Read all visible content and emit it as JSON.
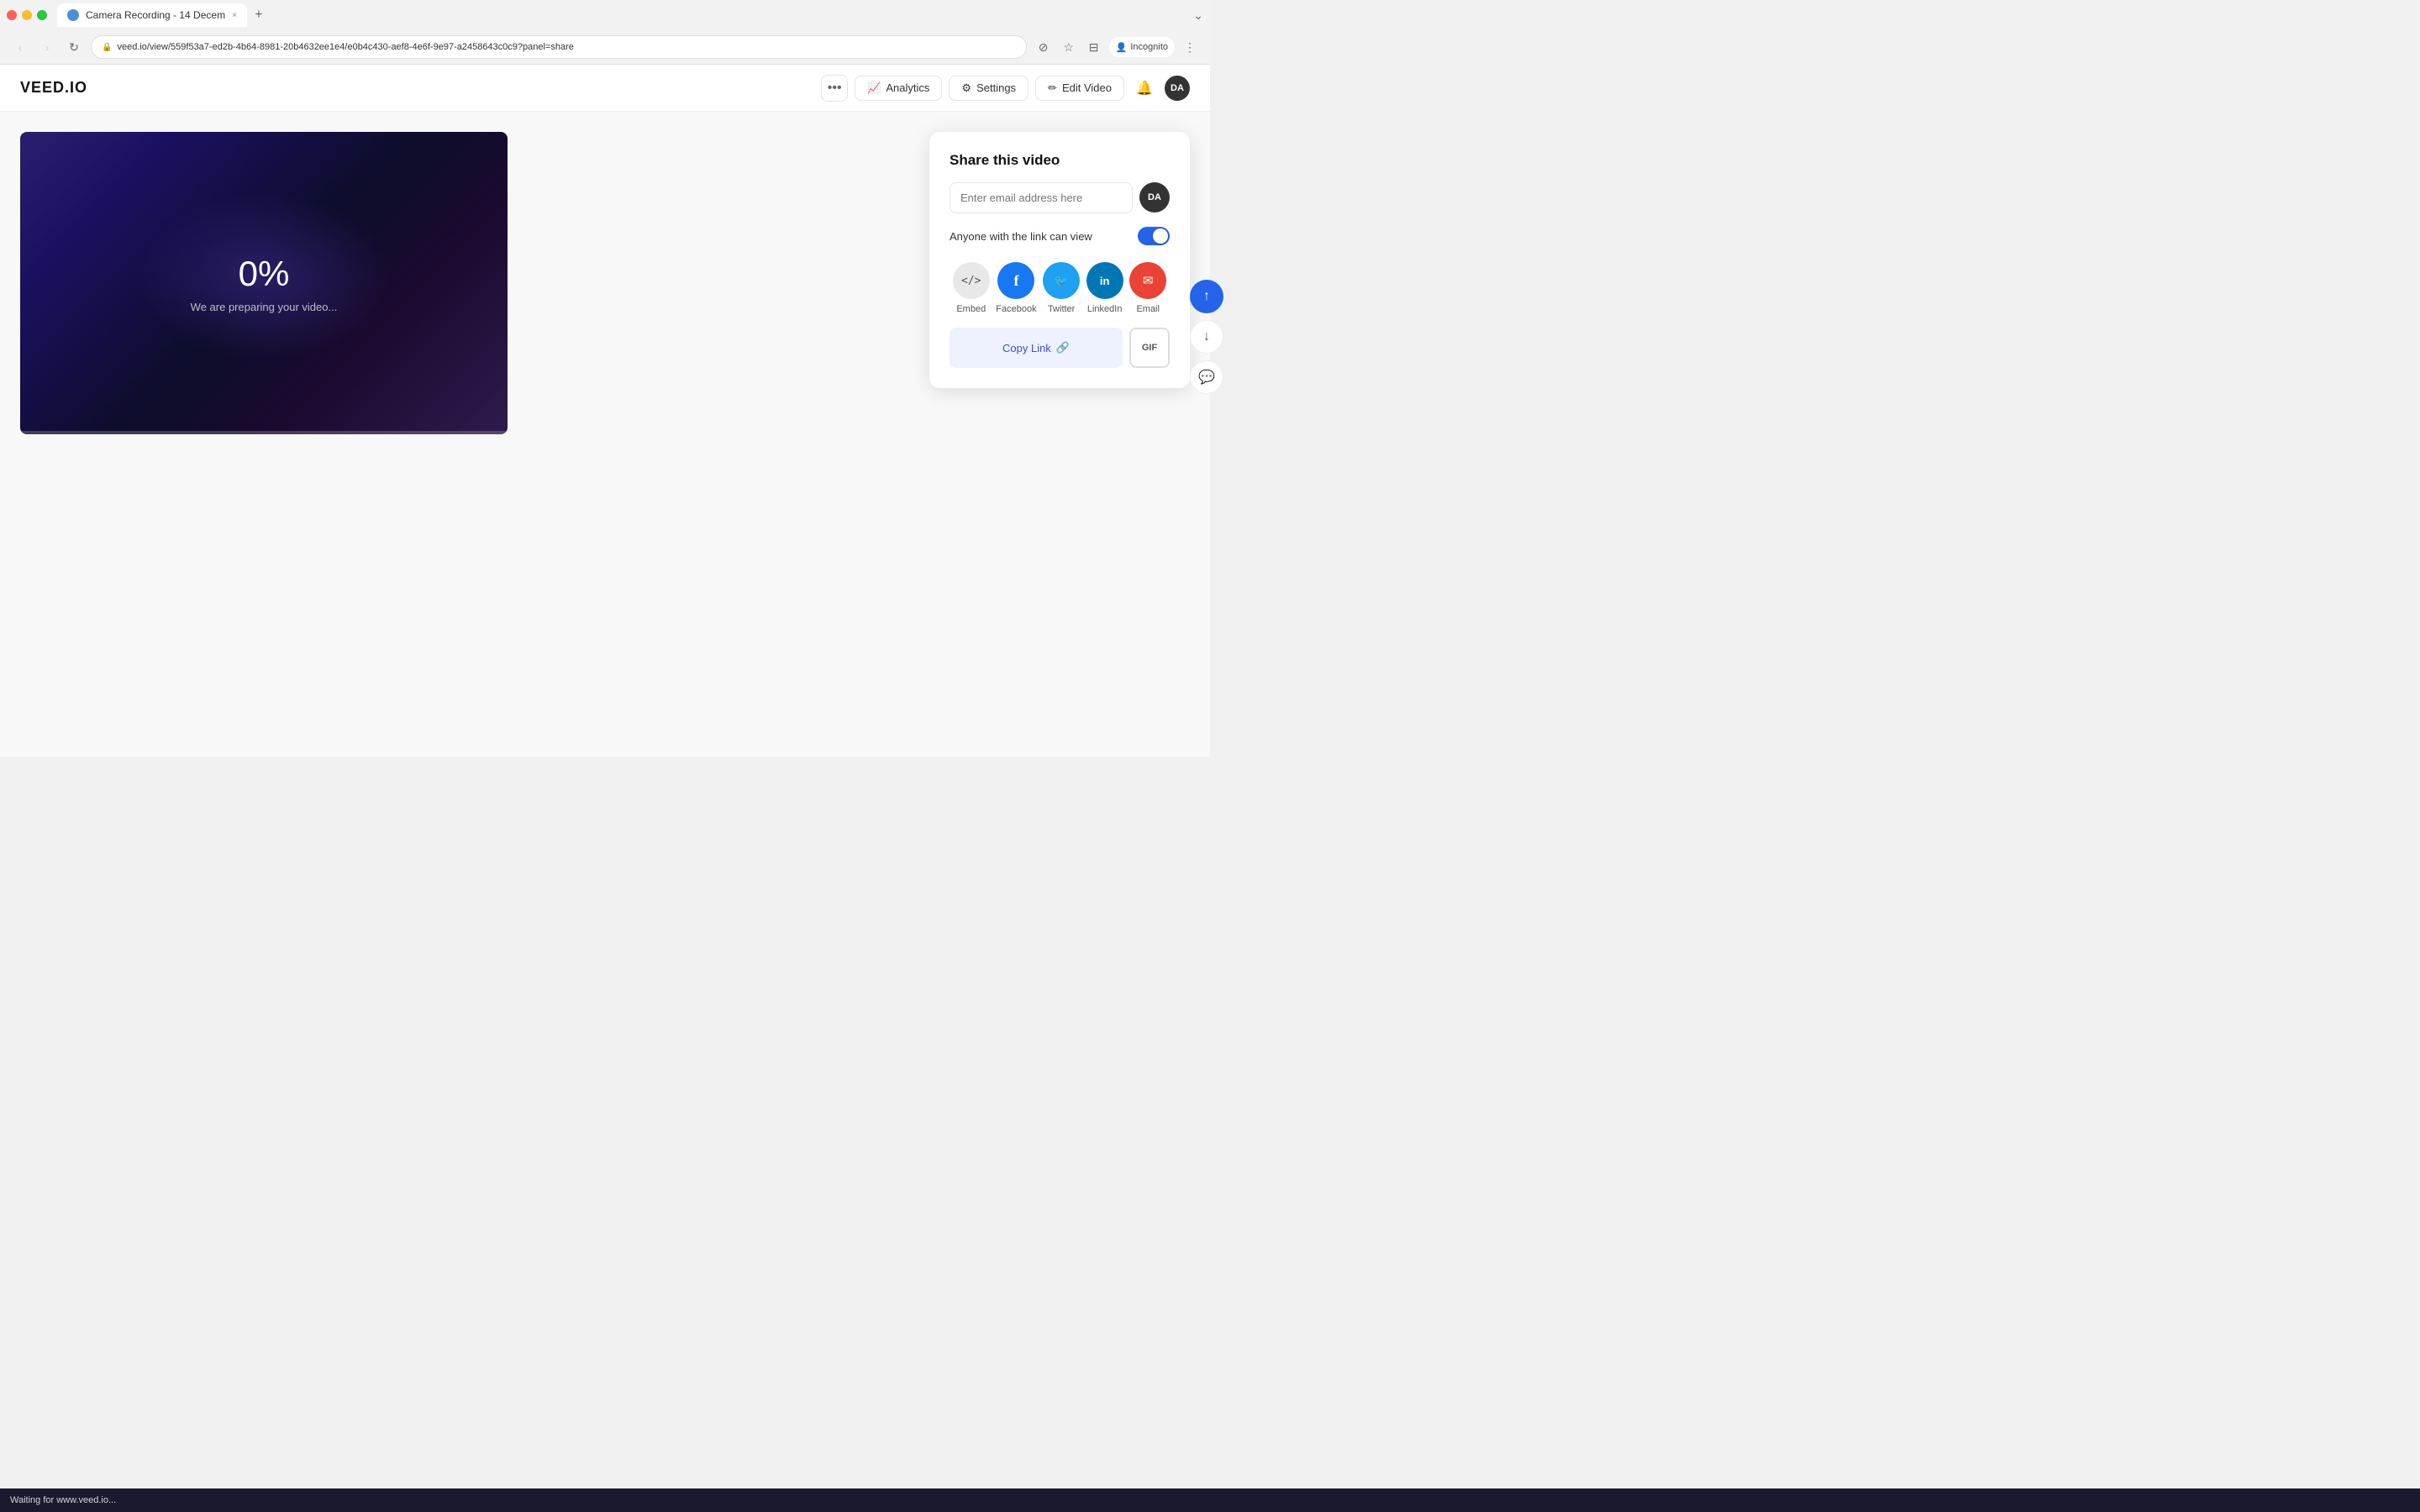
{
  "browser": {
    "tab_title": "Camera Recording - 14 Decem",
    "tab_close": "×",
    "tab_new": "+",
    "more_tabs": "⌄",
    "url": "veed.io/view/559f53a7-ed2b-4b64-8981-20b4632ee1e4/e0b4c430-aef8-4e6f-9e97-a2458643c0c9?panel=share",
    "lock_icon": "🔒",
    "nav_back": "‹",
    "nav_forward": "›",
    "nav_refresh": "↻",
    "incognito_label": "Incognito",
    "action_icons": [
      "⋮",
      "★",
      "⊟",
      "👤"
    ]
  },
  "header": {
    "logo": "VEED.IO",
    "more_label": "•••",
    "analytics_label": "Analytics",
    "settings_label": "Settings",
    "edit_video_label": "Edit Video",
    "notification_icon": "🔔",
    "avatar_label": "DA"
  },
  "video": {
    "progress": "0%",
    "preparing_text": "We are preparing your video...",
    "progress_fill": 0
  },
  "share_panel": {
    "title": "Share this video",
    "email_placeholder": "Enter email address here",
    "avatar_label": "DA",
    "link_toggle_label": "Anyone with the link can view",
    "social_items": [
      {
        "id": "embed",
        "label": "Embed",
        "icon": "</>",
        "style": "embed"
      },
      {
        "id": "facebook",
        "label": "Facebook",
        "icon": "f",
        "style": "facebook"
      },
      {
        "id": "twitter",
        "label": "Twitter",
        "icon": "🐦",
        "style": "twitter"
      },
      {
        "id": "linkedin",
        "label": "LinkedIn",
        "icon": "in",
        "style": "linkedin"
      },
      {
        "id": "email",
        "label": "Email",
        "icon": "✉",
        "style": "email"
      }
    ],
    "copy_link_label": "Copy Link",
    "copy_link_icon": "🔗",
    "gif_label": "GIF"
  },
  "sidebar": {
    "share_icon": "↑",
    "download_icon": "↓",
    "comment_icon": "💬"
  },
  "status_bar": {
    "text": "Waiting for www.veed.io..."
  }
}
